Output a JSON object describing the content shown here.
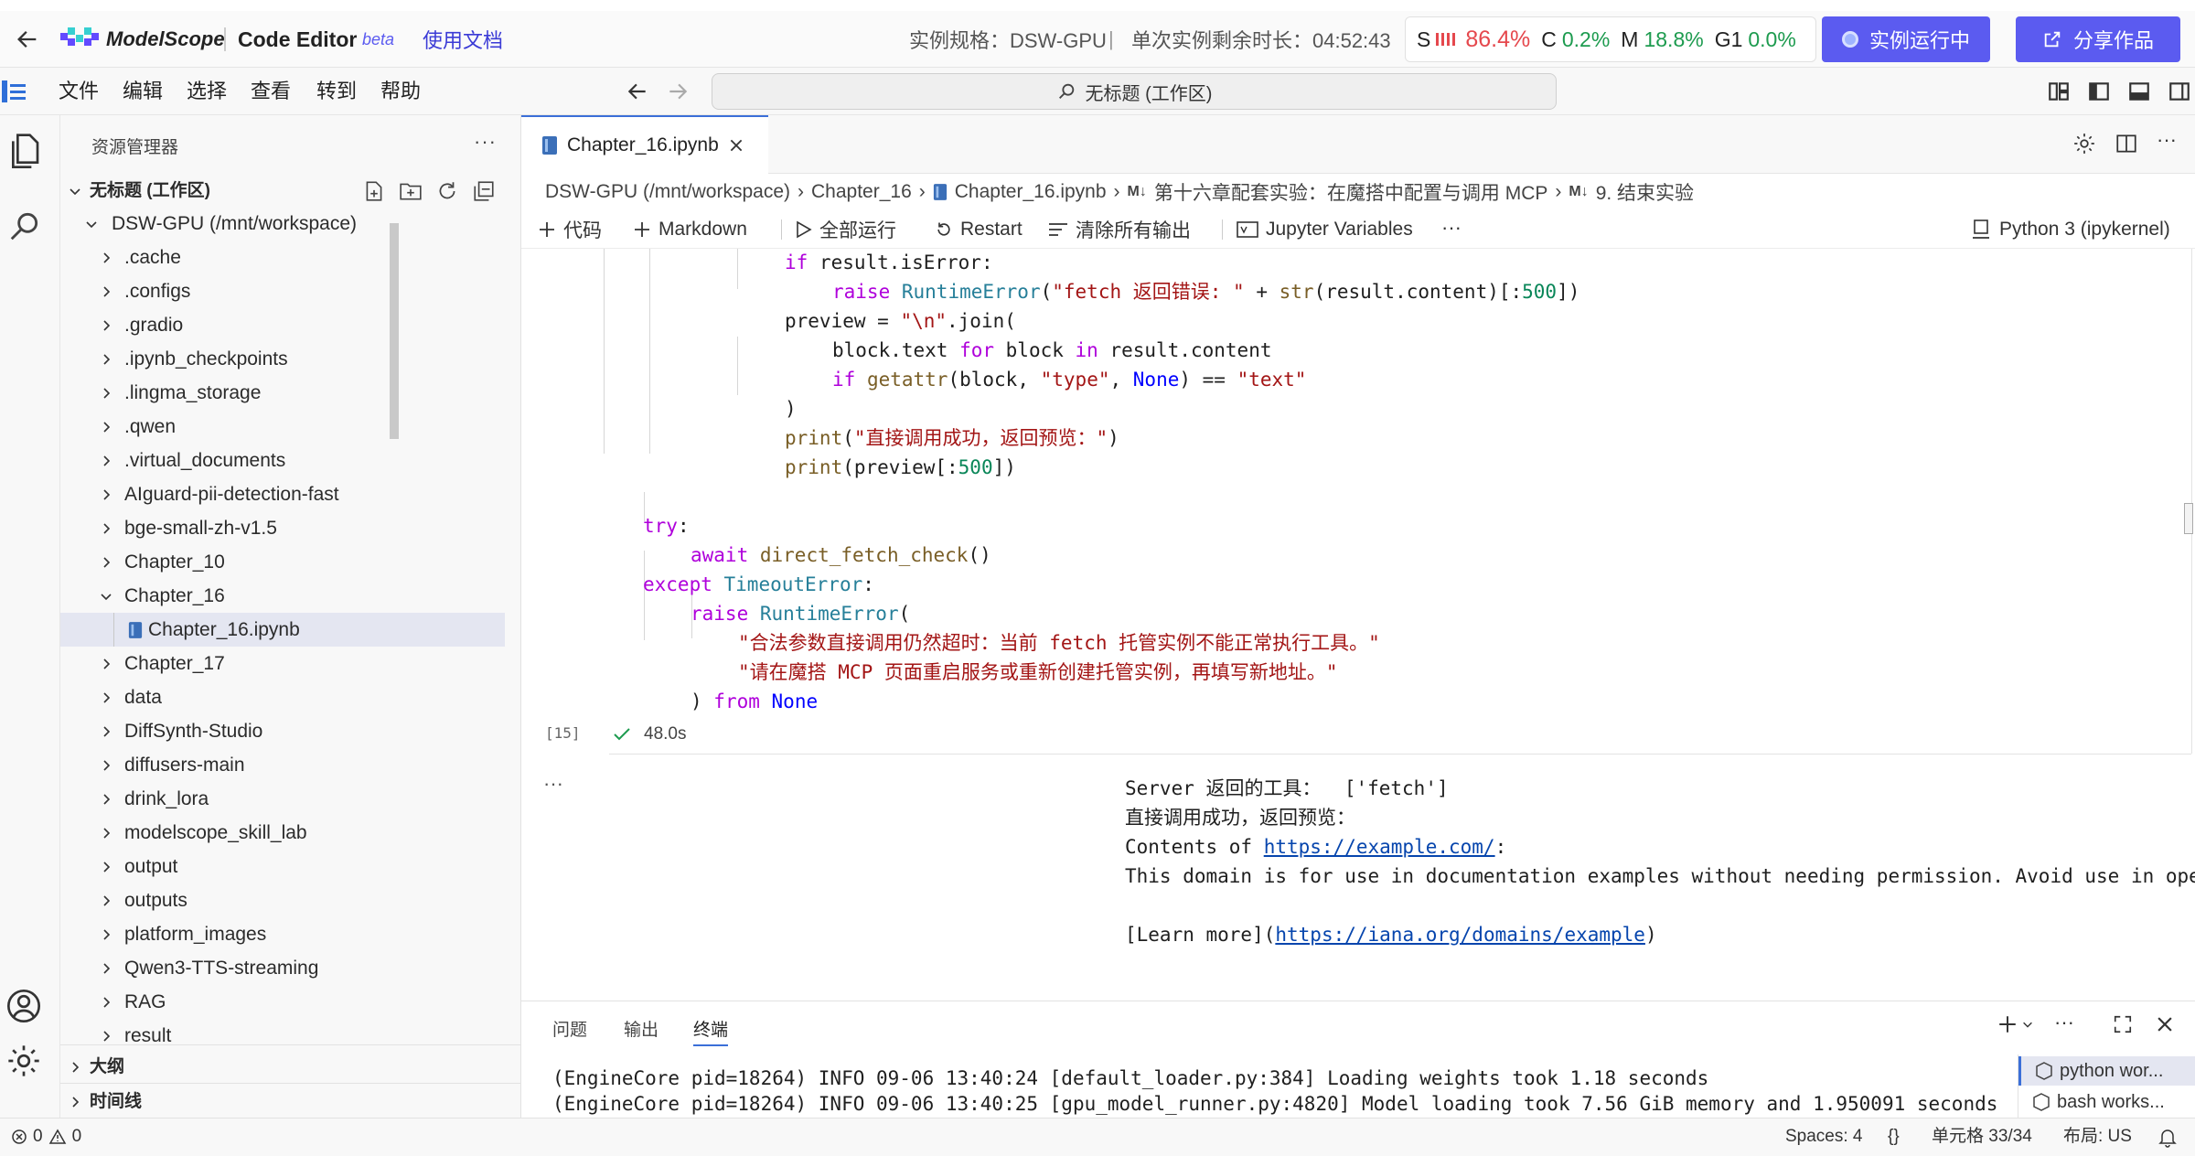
{
  "header": {
    "logo_text": "ModelScope",
    "app_title": "Code Editor",
    "beta_badge": "beta",
    "docs_link": "使用文档",
    "instance_spec": "实例规格：DSW-GPU",
    "separator": "|",
    "remaining_time": "单次实例剩余时长：04:52:43",
    "metrics": {
      "s_label": "S",
      "s_value": "86.4%",
      "c_label": "C",
      "c_value": "0.2%",
      "m_label": "M",
      "m_value": "18.8%",
      "g_label": "G1",
      "g_value": "0.0%"
    },
    "running_button": "实例运行中",
    "share_button": "分享作品",
    "colors": {
      "accent": "#5b5bf0",
      "danger": "#e5484d",
      "success": "#1d9b4f",
      "brand_blue": "#3b3bd6"
    }
  },
  "menu": {
    "items": [
      "文件",
      "编辑",
      "选择",
      "查看",
      "转到",
      "帮助"
    ],
    "command_center": "无标题 (工作区)"
  },
  "explorer": {
    "title": "资源管理器",
    "workspace": "无标题 (工作区)",
    "root": "DSW-GPU (/mnt/workspace)",
    "items": [
      ".cache",
      ".configs",
      ".gradio",
      ".ipynb_checkpoints",
      ".lingma_storage",
      ".qwen",
      ".virtual_documents",
      "AIguard-pii-detection-fast",
      "bge-small-zh-v1.5",
      "Chapter_10",
      "Chapter_16",
      "Chapter_16.ipynb",
      "Chapter_17",
      "data",
      "DiffSynth-Studio",
      "diffusers-main",
      "drink_lora",
      "modelscope_skill_lab",
      "output",
      "outputs",
      "platform_images",
      "Qwen3-TTS-streaming",
      "RAG",
      "result"
    ],
    "outline": "大纲",
    "timeline": "时间线"
  },
  "editor": {
    "tab_label": "Chapter_16.ipynb",
    "breadcrumb": {
      "root": "DSW-GPU (/mnt/workspace)",
      "folder": "Chapter_16",
      "file": "Chapter_16.ipynb",
      "md_badge": "M↓",
      "section": "第十六章配套实验：在魔搭中配置与调用 MCP",
      "subsection": "9. 结束实验"
    },
    "toolbar": {
      "code": "代码",
      "markdown": "Markdown",
      "run_all": "全部运行",
      "restart": "Restart",
      "clear_outputs": "清除所有输出",
      "variables": "Jupyter Variables",
      "more": "···",
      "kernel": "Python 3 (ipykernel)"
    },
    "cell": {
      "exec_count": "[15]",
      "duration": "48.0s"
    },
    "output": {
      "line1_prefix": "Server 返回的工具：",
      "line1_value": "['fetch']",
      "line2": "直接调用成功，返回预览：",
      "line3_prefix": "Contents of ",
      "line3_link": "https://example.com/",
      "line3_suffix": ":",
      "line4": "This domain is for use in documentation examples without needing permission. Avoid use in operations.",
      "line5_prefix": "[Learn more](",
      "line5_link": "https://iana.org/domains/example",
      "line5_suffix": ")"
    }
  },
  "panel": {
    "tabs": [
      "问题",
      "输出",
      "终端"
    ],
    "active_tab": "终端",
    "terminal_lines": [
      "(EngineCore pid=18264) INFO 09-06 13:40:24 [default_loader.py:384] Loading weights took 1.18 seconds",
      "(EngineCore pid=18264) INFO 09-06 13:40:25 [gpu_model_runner.py:4820] Model loading took 7.56 GiB memory and 1.950091 seconds"
    ],
    "terminals": [
      "python wor...",
      "bash works..."
    ]
  },
  "status": {
    "errors": "0",
    "warnings": "0",
    "spaces": "Spaces: 4",
    "braces": "{}",
    "cell_pos": "单元格 33/34",
    "layout": "布局: US"
  }
}
